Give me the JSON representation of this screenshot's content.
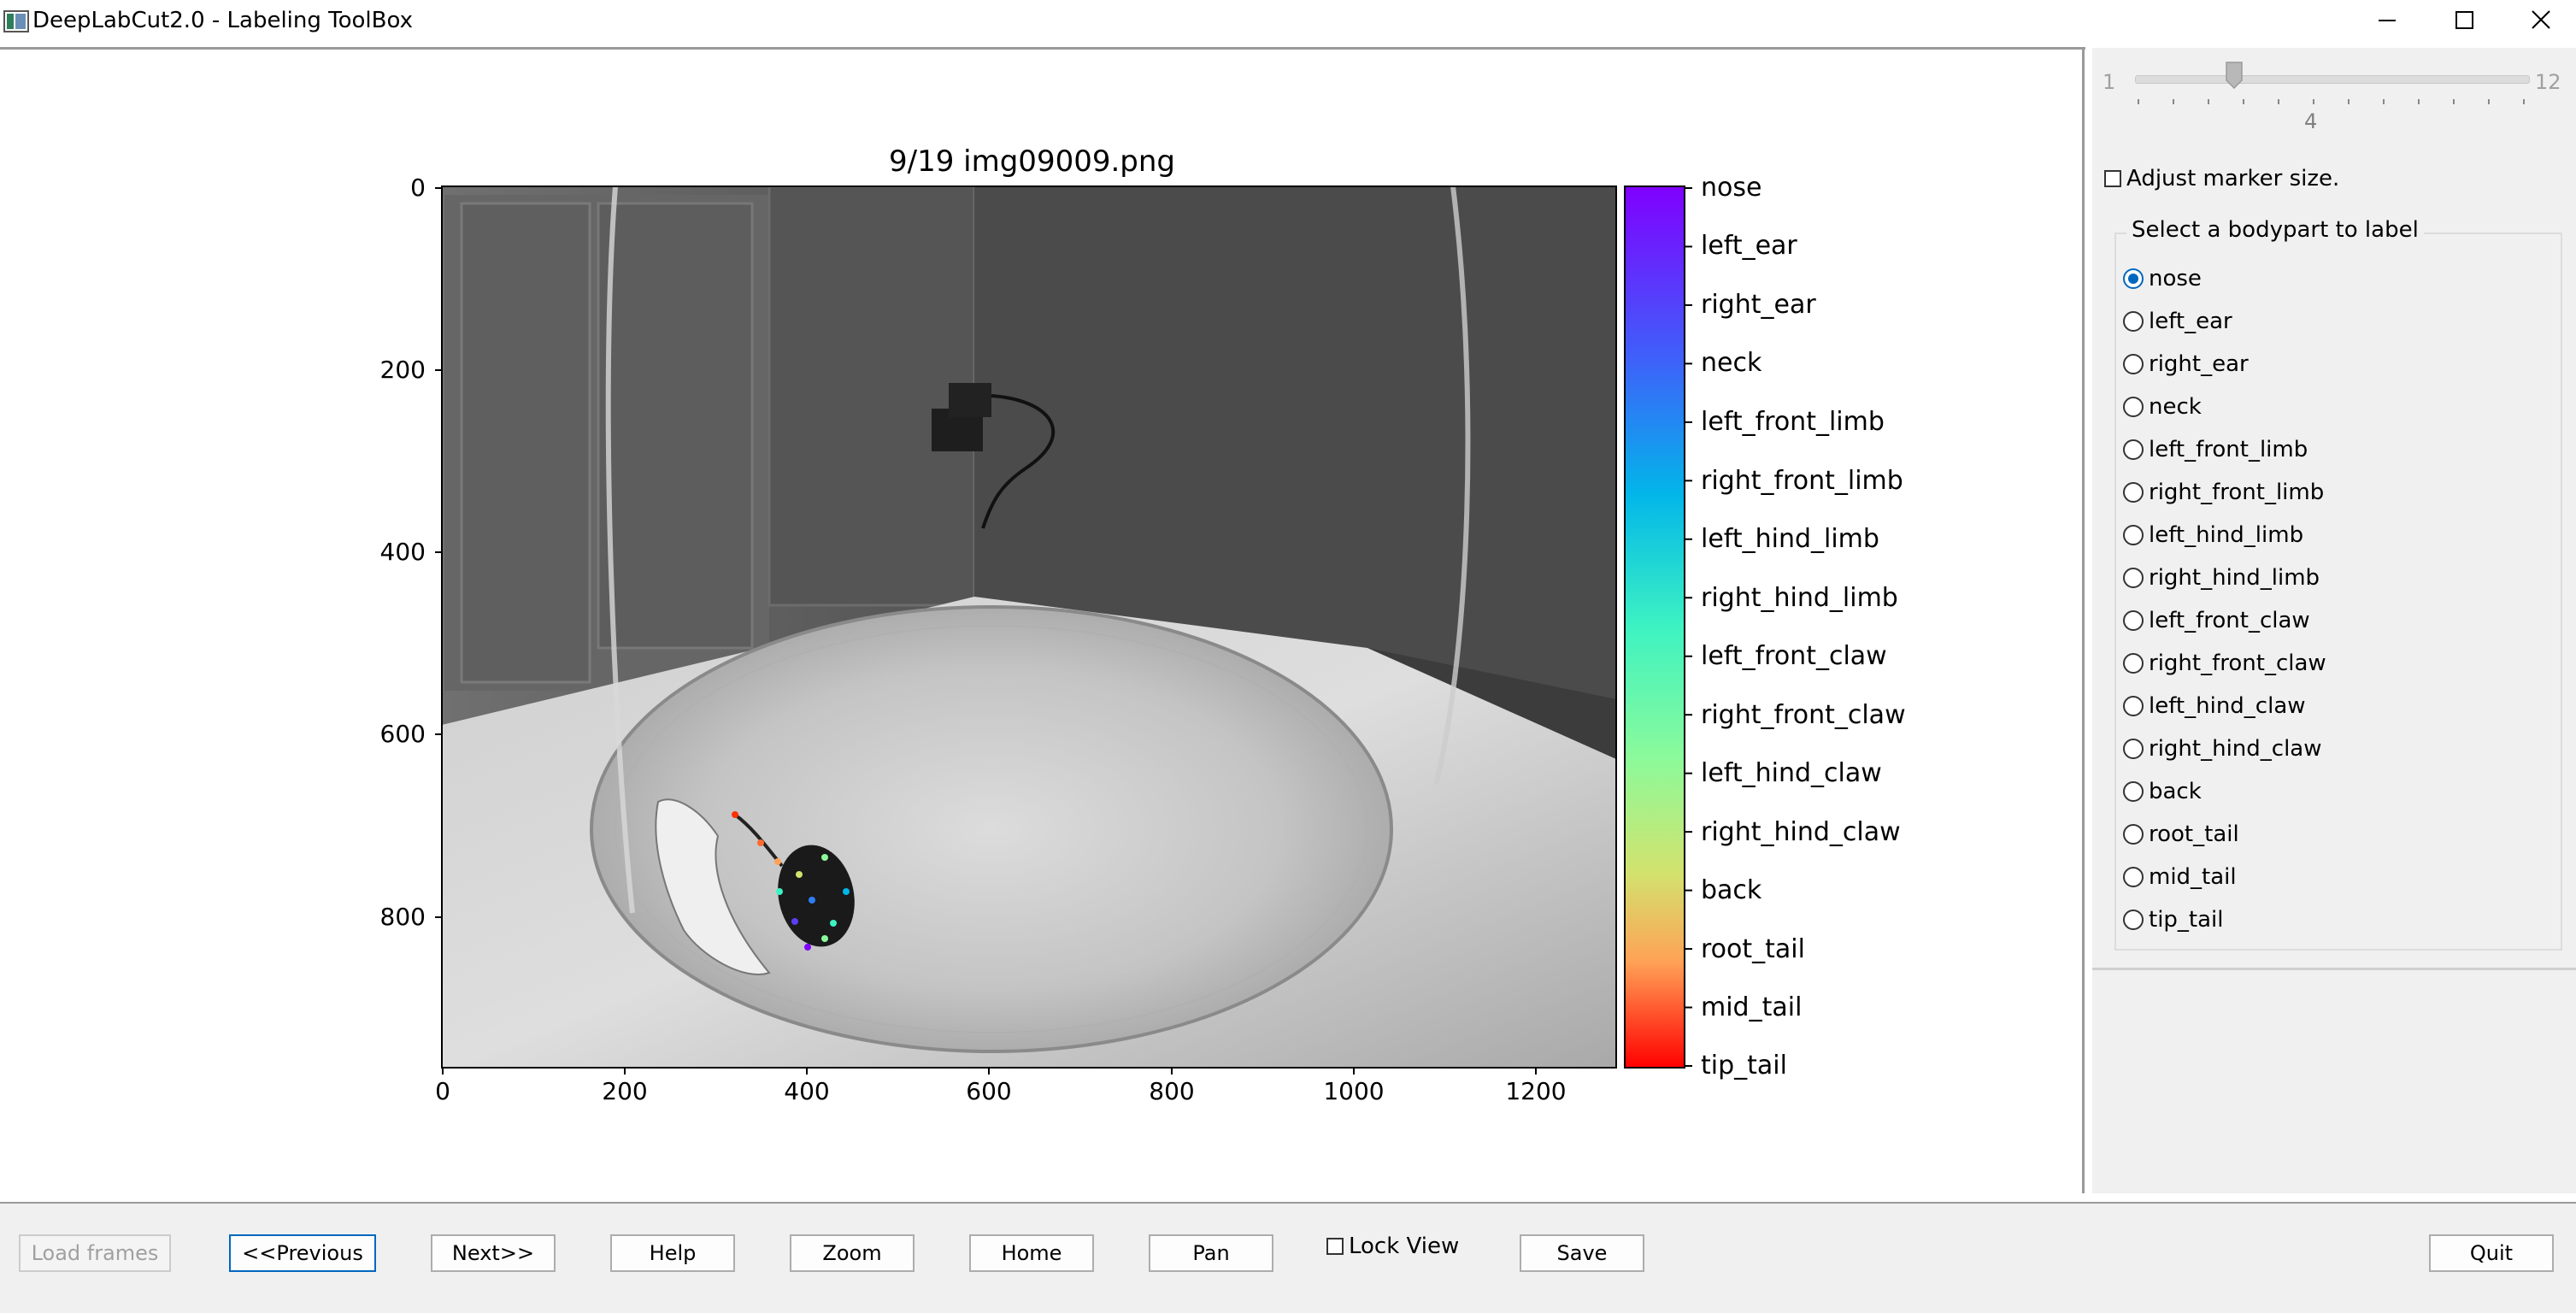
{
  "window": {
    "title": "DeepLabCut2.0 - Labeling ToolBox",
    "minimize_icon": "minimize-icon",
    "maximize_icon": "maximize-icon",
    "close_icon": "close-icon"
  },
  "figure": {
    "title": "9/19 img09009.png",
    "image_description_icon": "grayscale-camera-frame",
    "x_ticks": [
      "0",
      "200",
      "400",
      "600",
      "800",
      "1000",
      "1200"
    ],
    "y_ticks": [
      "0",
      "200",
      "400",
      "600",
      "800"
    ],
    "colorbar_labels": [
      "nose",
      "left_ear",
      "right_ear",
      "neck",
      "left_front_limb",
      "right_front_limb",
      "left_hind_limb",
      "right_hind_limb",
      "left_front_claw",
      "right_front_claw",
      "left_hind_claw",
      "right_hind_claw",
      "back",
      "root_tail",
      "mid_tail",
      "tip_tail"
    ],
    "colormap": "rainbow",
    "colormap_top": "#8000ff",
    "colormap_bottom": "#ff0000"
  },
  "panel": {
    "slider": {
      "min": "1",
      "max": "12",
      "value": "4"
    },
    "adjust_marker_label": "Adjust marker size.",
    "adjust_marker_checked": false,
    "group_title": "Select a bodypart to label",
    "selected_bodypart": "nose",
    "bodyparts": [
      "nose",
      "left_ear",
      "right_ear",
      "neck",
      "left_front_limb",
      "right_front_limb",
      "left_hind_limb",
      "right_hind_limb",
      "left_front_claw",
      "right_front_claw",
      "left_hind_claw",
      "right_hind_claw",
      "back",
      "root_tail",
      "mid_tail",
      "tip_tail"
    ]
  },
  "toolbar": {
    "load_frames": "Load frames",
    "previous": "<<Previous",
    "next": "Next>>",
    "help": "Help",
    "zoom": "Zoom",
    "home": "Home",
    "pan": "Pan",
    "lock_view": "Lock View",
    "lock_view_checked": false,
    "save": "Save",
    "quit": "Quit"
  },
  "colors": {
    "accent": "#0067c0",
    "panel_bg": "#f0f0f0"
  }
}
